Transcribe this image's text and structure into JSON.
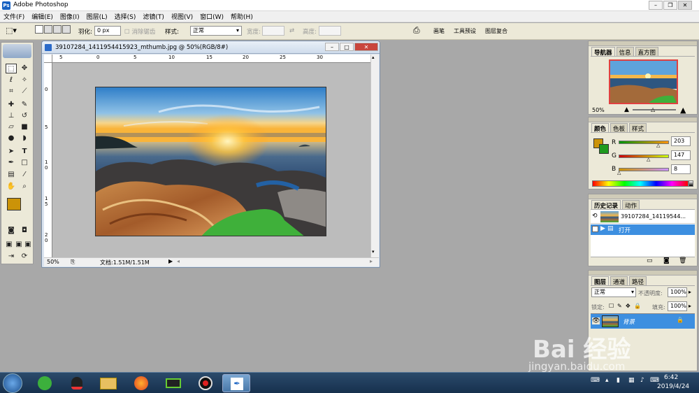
{
  "app": {
    "title": "Adobe Photoshop"
  },
  "menu": [
    "文件(F)",
    "编辑(E)",
    "图像(I)",
    "图层(L)",
    "选择(S)",
    "滤镜(T)",
    "视图(V)",
    "窗口(W)",
    "帮助(H)"
  ],
  "options": {
    "feather_label": "羽化:",
    "feather_value": "0 px",
    "antialias_label": "消除锯齿",
    "style_label": "样式:",
    "style_value": "正常",
    "width_label": "宽度:",
    "height_label": "高度:",
    "palette_tabs": [
      "画笔",
      "工具预设",
      "图层复合"
    ]
  },
  "document": {
    "title": "39107284_1411954415923_mthumb.jpg @ 50%(RGB/8#)",
    "zoom": "50%",
    "doc_size": "文档:1.51M/1.51M",
    "ruler_h": [
      "5",
      "0",
      "5",
      "10",
      "15",
      "20",
      "25",
      "30"
    ],
    "ruler_v": [
      "0",
      "5",
      "1 0",
      "1 5",
      "2 0"
    ]
  },
  "navigator": {
    "tabs": [
      "导航器",
      "信息",
      "直方图"
    ],
    "zoom": "50%"
  },
  "color": {
    "tabs": [
      "颜色",
      "色板",
      "样式"
    ],
    "r_label": "R",
    "r_value": "203",
    "g_label": "G",
    "g_value": "147",
    "b_label": "B",
    "b_value": "8",
    "foreground": "#cb9308",
    "background": "#1f9a1f"
  },
  "history": {
    "tabs": [
      "历史记录",
      "动作"
    ],
    "snapshot": "39107284_14119544...",
    "step": "打开"
  },
  "layers": {
    "tabs": [
      "图层",
      "通道",
      "路径"
    ],
    "blend": "正常",
    "opacity_label": "不透明度:",
    "opacity": "100%",
    "lock_label": "锁定:",
    "fill_label": "填充:",
    "fill": "100%",
    "layer_name": "背景"
  },
  "taskbar": {
    "time": "6:42",
    "date": "2019/4/24"
  },
  "watermark": {
    "brand": "Bai 经验",
    "url": "jingyan.baidu.com"
  }
}
